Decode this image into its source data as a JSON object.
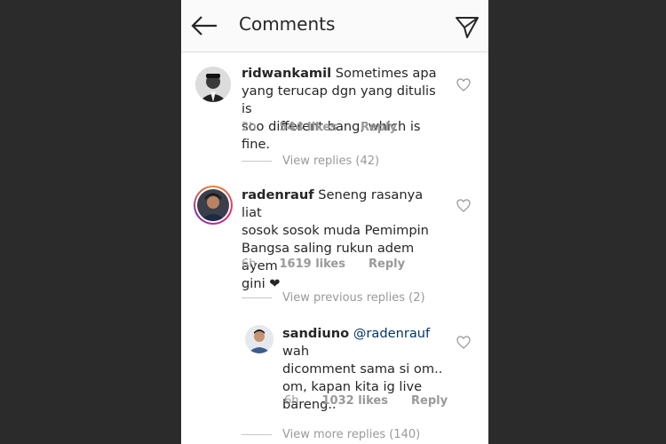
{
  "header": {
    "title": "Comments"
  },
  "comments": [
    {
      "username": "ridwankamil",
      "text_line1": "Sometimes apa",
      "text_rest": [
        "yang terucap dgn yang ditulis is",
        "soo different bang, which is fine."
      ],
      "time": "2h",
      "likes": "544 likes",
      "reply": "Reply",
      "view_replies": "View replies (42)"
    },
    {
      "username": "radenrauf",
      "text_line1": "Seneng rasanya liat",
      "text_rest": [
        "sosok sosok muda Pemimpin",
        "Bangsa saling rukun adem ayem",
        "gini ❤"
      ],
      "time": "6h",
      "likes": "1619 likes",
      "reply": "Reply",
      "view_replies": "View previous replies (2)"
    },
    {
      "username": "sandiuno",
      "mention": "@radenrauf",
      "text_line1_after": " wah",
      "text_rest": [
        "dicomment sama si om..",
        "om, kapan kita ig live",
        "bareng.."
      ],
      "time": "6h",
      "likes": "1032 likes",
      "reply": "Reply",
      "view_replies": "View more replies (140)"
    }
  ]
}
